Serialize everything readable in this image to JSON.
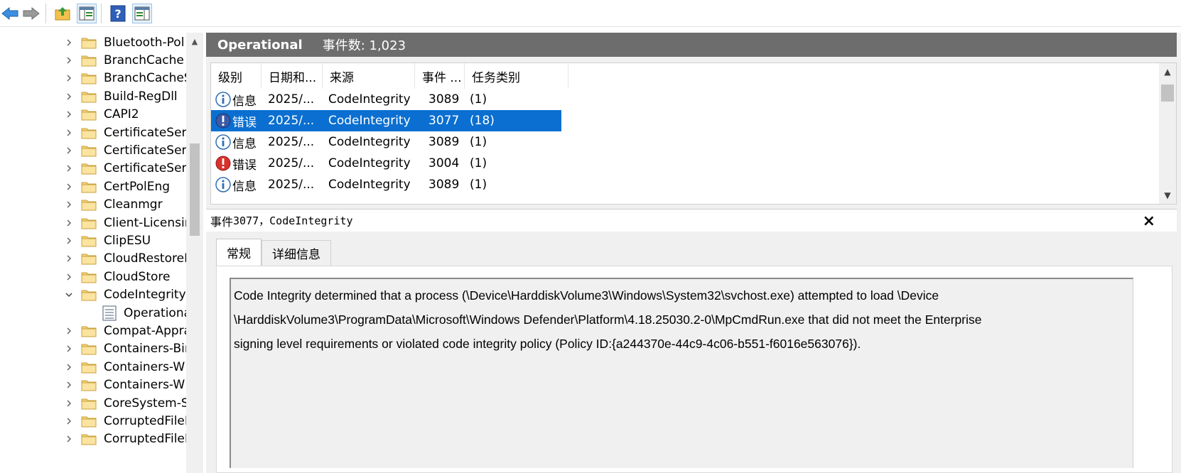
{
  "toolbar": {
    "buttons": [
      "back-icon",
      "forward-icon",
      "up-folder-icon",
      "show-hide-tree-icon",
      "help-icon",
      "show-hide-action-pane-icon"
    ]
  },
  "tree": {
    "items": [
      {
        "label": "Bluetooth-Pol",
        "expanded": false
      },
      {
        "label": "BranchCache",
        "expanded": false
      },
      {
        "label": "BranchCacheS",
        "expanded": false
      },
      {
        "label": "Build-RegDll",
        "expanded": false
      },
      {
        "label": "CAPI2",
        "expanded": false
      },
      {
        "label": "CertificateSer",
        "expanded": false
      },
      {
        "label": "CertificateSer",
        "expanded": false
      },
      {
        "label": "CertificateSer",
        "expanded": false
      },
      {
        "label": "CertPolEng",
        "expanded": false
      },
      {
        "label": "Cleanmgr",
        "expanded": false
      },
      {
        "label": "Client-Licensir",
        "expanded": false
      },
      {
        "label": "ClipESU",
        "expanded": false
      },
      {
        "label": "CloudRestoreI",
        "expanded": false
      },
      {
        "label": "CloudStore",
        "expanded": false
      },
      {
        "label": "CodeIntegrity",
        "expanded": true
      },
      {
        "label": "Operationa",
        "child": true
      },
      {
        "label": "Compat-Appra",
        "expanded": false
      },
      {
        "label": "Containers-Bir",
        "expanded": false
      },
      {
        "label": "Containers-W",
        "expanded": false
      },
      {
        "label": "Containers-W",
        "expanded": false
      },
      {
        "label": "CoreSystem-S",
        "expanded": false
      },
      {
        "label": "CorruptedFileI",
        "expanded": false
      },
      {
        "label": "CorruptedFileI",
        "expanded": false
      }
    ]
  },
  "header": {
    "log_name": "Operational",
    "event_count": "事件数: 1,023"
  },
  "list": {
    "columns": [
      "级别",
      "日期和...",
      "来源",
      "事件 ...",
      "任务类别"
    ],
    "rows": [
      {
        "level": "信息",
        "level_icon": "info-icon",
        "date": "2025/...",
        "source": "CodeIntegrity",
        "event_id": "3089",
        "task": "(1)",
        "selected": false
      },
      {
        "level": "错误",
        "level_icon": "error-icon",
        "date": "2025/...",
        "source": "CodeIntegrity",
        "event_id": "3077",
        "task": "(18)",
        "selected": true
      },
      {
        "level": "信息",
        "level_icon": "info-icon",
        "date": "2025/...",
        "source": "CodeIntegrity",
        "event_id": "3089",
        "task": "(1)",
        "selected": false
      },
      {
        "level": "错误",
        "level_icon": "error-icon",
        "date": "2025/...",
        "source": "CodeIntegrity",
        "event_id": "3004",
        "task": "(1)",
        "selected": false
      },
      {
        "level": "信息",
        "level_icon": "info-icon",
        "date": "2025/...",
        "source": "CodeIntegrity",
        "event_id": "3089",
        "task": "(1)",
        "selected": false
      }
    ]
  },
  "detail": {
    "title_prefix": "事件 ",
    "title_mono": "3077，CodeIntegrity",
    "close": "×",
    "tabs": [
      {
        "label": "常规",
        "active": true
      },
      {
        "label": "详细信息",
        "active": false
      }
    ],
    "description_lines": [
      "Code Integrity determined that a process (\\Device\\HarddiskVolume3\\Windows\\System32\\svchost.exe) attempted to load \\Device",
      "\\HarddiskVolume3\\ProgramData\\Microsoft\\Windows Defender\\Platform\\4.18.25030.2-0\\MpCmdRun.exe that did not meet the Enterprise",
      "signing level requirements or violated code integrity policy (Policy ID:{a244370e-44c9-4c06-b551-f6016e563076})."
    ]
  },
  "colors": {
    "header_bg": "#6d6d6d",
    "selection": "#0a6fd0",
    "info_blue": "#2f6fb6",
    "error_red": "#d9312b"
  }
}
